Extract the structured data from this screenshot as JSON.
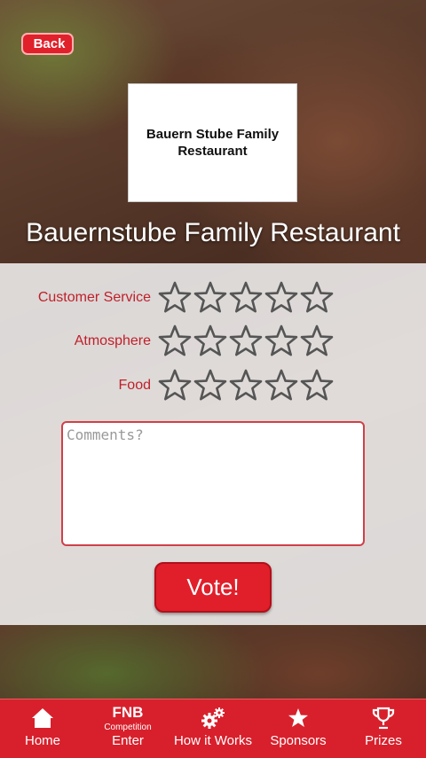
{
  "nav": {
    "back_label": "Back"
  },
  "logo": {
    "line1": "Bauern Stube Family",
    "line2": "Restaurant"
  },
  "restaurant": {
    "name": "Bauernstube Family Restaurant"
  },
  "ratings": [
    {
      "label": "Customer Service",
      "stars": 0,
      "max": 5
    },
    {
      "label": "Atmosphere",
      "stars": 0,
      "max": 5
    },
    {
      "label": "Food",
      "stars": 0,
      "max": 5
    }
  ],
  "comments": {
    "placeholder": "Comments?",
    "value": ""
  },
  "vote": {
    "label": "Vote!"
  },
  "colors": {
    "accent": "#e0202a",
    "label": "#c0202a",
    "tabbar": "#d8202c"
  },
  "tabbar": {
    "home": {
      "label": "Home",
      "icon": "house-icon"
    },
    "enter": {
      "title": "FNB",
      "subtitle": "Competition",
      "label": "Enter"
    },
    "how": {
      "label": "How it Works",
      "icon": "gears-icon"
    },
    "sponsors": {
      "label": "Sponsors",
      "icon": "star-icon"
    },
    "prizes": {
      "label": "Prizes",
      "icon": "trophy-icon"
    }
  }
}
